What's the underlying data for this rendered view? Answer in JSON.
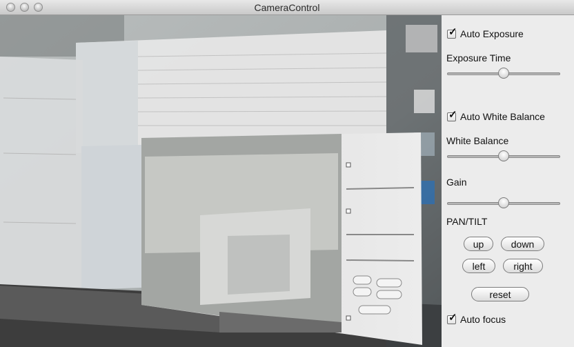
{
  "window": {
    "title": "CameraControl"
  },
  "controls": {
    "auto_exposure": {
      "label": "Auto Exposure",
      "checked": true
    },
    "exposure_time": {
      "label": "Exposure Time",
      "value": 0.5
    },
    "auto_white_balance": {
      "label": "Auto White Balance",
      "checked": true
    },
    "white_balance": {
      "label": "White Balance",
      "value": 0.5
    },
    "gain": {
      "label": "Gain",
      "value": 0.5
    },
    "pan_tilt": {
      "label": "PAN/TILT",
      "up": "up",
      "down": "down",
      "left": "left",
      "right": "right",
      "reset": "reset"
    },
    "auto_focus": {
      "label": "Auto focus",
      "checked": true
    }
  },
  "colors": {
    "panel_bg": "#ececec",
    "titlebar_top": "#e8e8e8",
    "titlebar_bottom": "#c9c9c9"
  },
  "icons": {
    "checkbox_checked": "checkmark-icon",
    "traffic_lights": "window-button-icon"
  }
}
